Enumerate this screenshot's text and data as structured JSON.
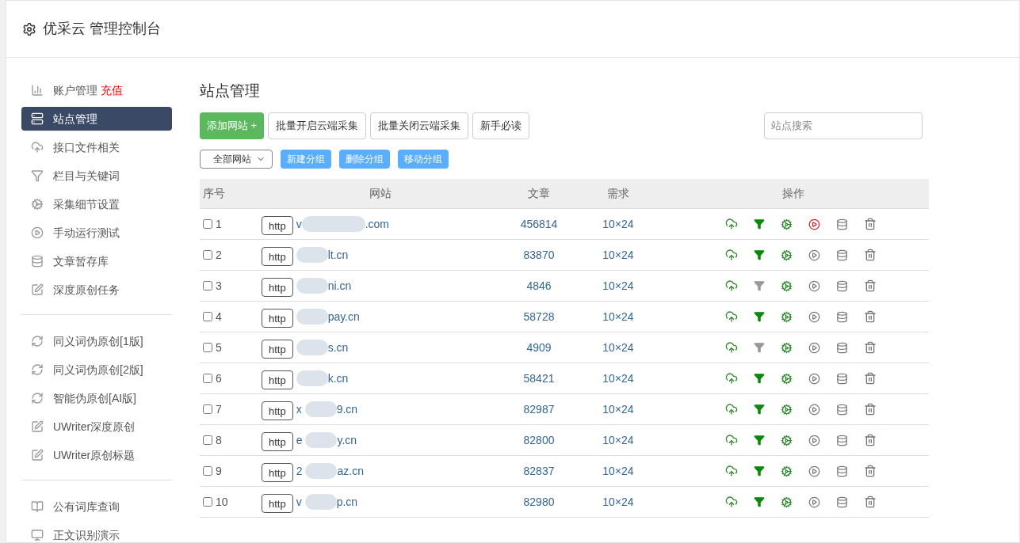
{
  "header": {
    "title": "优采云 管理控制台"
  },
  "sidebar": {
    "groups": [
      {
        "items": [
          {
            "label": "账户管理",
            "badge": "充值",
            "selected": false
          },
          {
            "label": "站点管理",
            "selected": true
          },
          {
            "label": "接口文件相关",
            "selected": false
          },
          {
            "label": "栏目与关键词",
            "selected": false
          },
          {
            "label": "采集细节设置",
            "selected": false
          },
          {
            "label": "手动运行测试",
            "selected": false
          },
          {
            "label": "文章暂存库",
            "selected": false
          },
          {
            "label": "深度原创任务",
            "selected": false
          }
        ]
      },
      {
        "items": [
          {
            "label": "同义词伪原创[1版]",
            "selected": false
          },
          {
            "label": "同义词伪原创[2版]",
            "selected": false
          },
          {
            "label": "智能伪原创[AI版]",
            "selected": false
          },
          {
            "label": "UWriter深度原创",
            "selected": false
          },
          {
            "label": "UWriter原创标题",
            "selected": false
          }
        ]
      },
      {
        "items": [
          {
            "label": "公有词库查询",
            "selected": false
          },
          {
            "label": "正文识别演示",
            "selected": false
          }
        ]
      }
    ]
  },
  "main": {
    "title": "站点管理",
    "buttons": [
      {
        "label": "添加网站 +",
        "kind": "primary"
      },
      {
        "label": "批量开启云端采集",
        "kind": "default"
      },
      {
        "label": "批量关闭云端采集",
        "kind": "default"
      },
      {
        "label": "新手必读",
        "kind": "default"
      }
    ],
    "search": {
      "placeholder": "站点搜索"
    },
    "group_select": {
      "value": "全部网站"
    },
    "group_buttons": [
      "新建分组",
      "删除分组",
      "移动分组"
    ],
    "table": {
      "columns": [
        "序号",
        "网站",
        "文章",
        "需求",
        "操作"
      ],
      "rows": [
        {
          "no": "1",
          "checked": false,
          "scheme": "http",
          "domain_start": "v",
          "domain_end": ".com",
          "articles": "456814",
          "demand": "10×24",
          "filter_on": true,
          "running": true
        },
        {
          "no": "2",
          "checked": false,
          "scheme": "http",
          "domain_end": "lt.cn",
          "articles": "83870",
          "demand": "10×24",
          "filter_on": true,
          "running": false
        },
        {
          "no": "3",
          "checked": false,
          "scheme": "http",
          "domain_end": "ni.cn",
          "articles": "4846",
          "demand": "10×24",
          "filter_on": false,
          "running": false
        },
        {
          "no": "4",
          "checked": false,
          "scheme": "http",
          "domain_end": "pay.cn",
          "articles": "58728",
          "demand": "10×24",
          "filter_on": true,
          "running": false
        },
        {
          "no": "5",
          "checked": false,
          "scheme": "http",
          "domain_end": "s.cn",
          "articles": "4909",
          "demand": "10×24",
          "filter_on": false,
          "running": false
        },
        {
          "no": "6",
          "checked": false,
          "scheme": "http",
          "domain_end": "k.cn",
          "articles": "58421",
          "demand": "10×24",
          "filter_on": true,
          "running": false
        },
        {
          "no": "7",
          "checked": false,
          "scheme": "http",
          "domain_start": "x",
          "domain_end": "9.cn",
          "articles": "82987",
          "demand": "10×24",
          "filter_on": true,
          "running": false
        },
        {
          "no": "8",
          "checked": false,
          "scheme": "http",
          "domain_start": "e",
          "domain_end": "y.cn",
          "articles": "82800",
          "demand": "10×24",
          "filter_on": true,
          "running": false
        },
        {
          "no": "9",
          "checked": false,
          "scheme": "http",
          "domain_start": "2",
          "domain_end": "az.cn",
          "articles": "82837",
          "demand": "10×24",
          "filter_on": true,
          "running": false
        },
        {
          "no": "10",
          "checked": false,
          "scheme": "http",
          "domain_start": "v",
          "domain_end": "p.cn",
          "articles": "82980",
          "demand": "10×24",
          "filter_on": true,
          "running": false
        }
      ]
    }
  }
}
